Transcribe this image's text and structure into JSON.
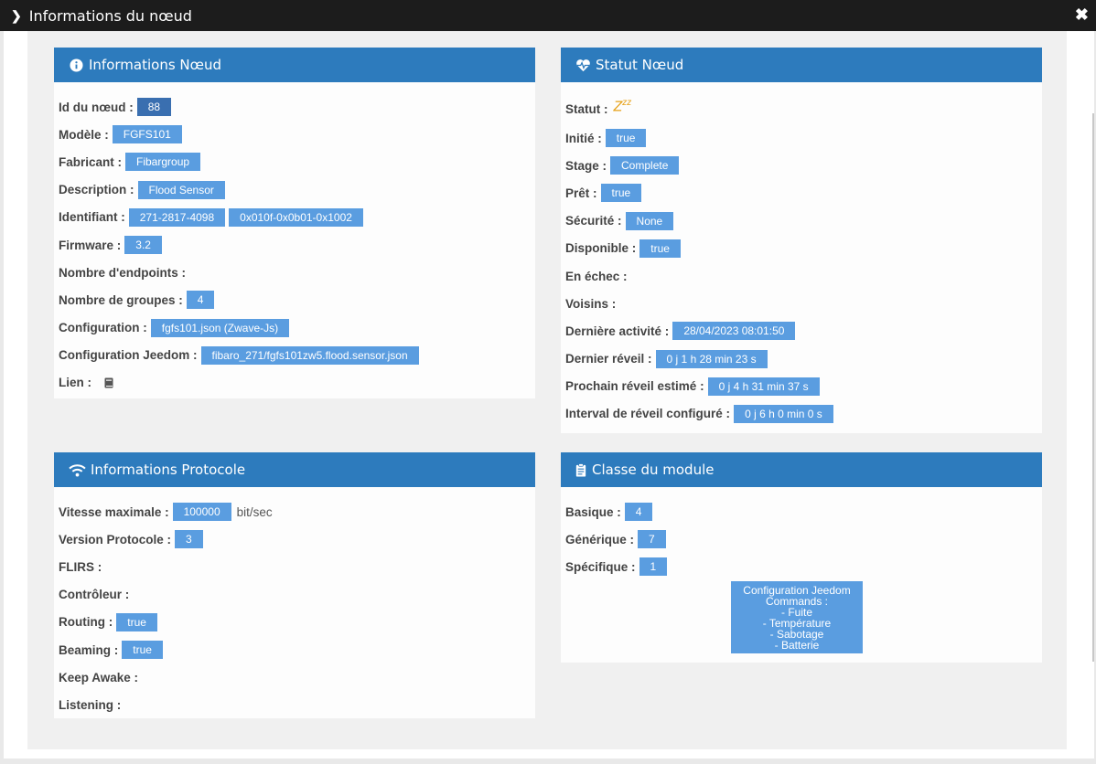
{
  "window": {
    "title": "Informations du nœud"
  },
  "node_info": {
    "title": "Informations Nœud",
    "rows": [
      {
        "label": "Id du nœud :",
        "values": [
          "88"
        ]
      },
      {
        "label": "Modèle :",
        "values": [
          "FGFS101"
        ]
      },
      {
        "label": "Fabricant :",
        "values": [
          "Fibargroup"
        ]
      },
      {
        "label": "Description :",
        "values": [
          "Flood Sensor"
        ]
      },
      {
        "label": "Identifiant :",
        "values": [
          "271-2817-4098",
          "0x010f-0x0b01-0x1002"
        ]
      },
      {
        "label": "Firmware :",
        "values": [
          "3.2"
        ]
      },
      {
        "label": "Nombre d'endpoints :",
        "values": []
      },
      {
        "label": "Nombre de groupes :",
        "values": [
          "4"
        ]
      },
      {
        "label": "Configuration :",
        "values": [
          "fgfs101.json (Zwave-Js)"
        ]
      },
      {
        "label": "Configuration Jeedom :",
        "values": [
          "fibaro_271/fgfs101zw5.flood.sensor.json"
        ]
      },
      {
        "label": "Lien :",
        "values": []
      }
    ]
  },
  "node_status": {
    "title": "Statut Nœud",
    "status_label": "Statut :",
    "status_icon_text": "Z",
    "status_icon_sup": "zz",
    "rows": [
      {
        "label": "Initié :",
        "values": [
          "true"
        ]
      },
      {
        "label": "Stage :",
        "values": [
          "Complete"
        ]
      },
      {
        "label": "Prêt :",
        "values": [
          "true"
        ]
      },
      {
        "label": "Sécurité :",
        "values": [
          "None"
        ]
      },
      {
        "label": "Disponible :",
        "values": [
          "true"
        ]
      },
      {
        "label": "En échec :",
        "values": []
      },
      {
        "label": "Voisins :",
        "values": []
      },
      {
        "label": "Dernière activité :",
        "values": [
          "28/04/2023 08:01:50"
        ]
      },
      {
        "label": "Dernier réveil :",
        "values": [
          "0 j 1 h 28 min 23 s"
        ]
      },
      {
        "label": "Prochain réveil estimé :",
        "values": [
          "0 j 4 h 31 min 37 s"
        ]
      },
      {
        "label": "Interval de réveil configuré :",
        "values": [
          "0 j 6 h 0 min 0 s"
        ]
      }
    ]
  },
  "protocol_info": {
    "title": "Informations Protocole",
    "rows": [
      {
        "label": "Vitesse maximale :",
        "values": [
          "100000"
        ],
        "unit": "bit/sec"
      },
      {
        "label": "Version Protocole :",
        "values": [
          "3"
        ]
      },
      {
        "label": "FLIRS :",
        "values": []
      },
      {
        "label": "Contrôleur :",
        "values": []
      },
      {
        "label": "Routing :",
        "values": [
          "true"
        ]
      },
      {
        "label": "Beaming :",
        "values": [
          "true"
        ]
      },
      {
        "label": "Keep Awake :",
        "values": []
      },
      {
        "label": "Listening :",
        "values": []
      }
    ]
  },
  "module_class": {
    "title": "Classe du module",
    "rows": [
      {
        "label": "Basique :",
        "values": [
          "4"
        ]
      },
      {
        "label": "Générique :",
        "values": [
          "7"
        ]
      },
      {
        "label": "Spécifique :",
        "values": [
          "1"
        ]
      }
    ],
    "config_lines": [
      "Configuration Jeedom",
      "Commands :",
      "- Fuite",
      "- Température",
      "- Sabotage",
      "- Batterie"
    ]
  },
  "colors": {
    "header": "#2d7bbd",
    "badge": "#5a9de0",
    "titlebar": "#1c1c1c",
    "zzz": "#e6a21a"
  }
}
